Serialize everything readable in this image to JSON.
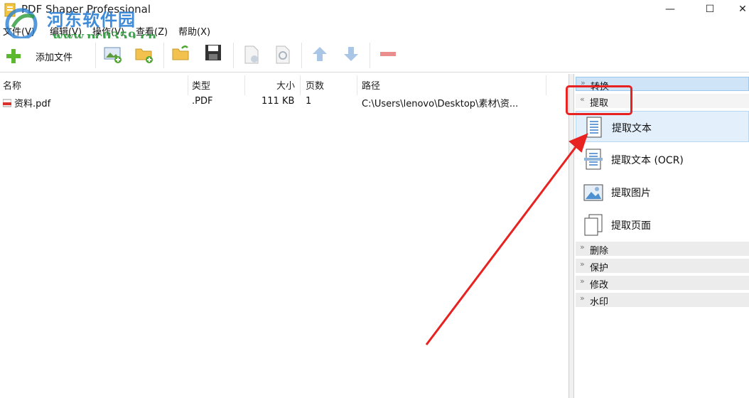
{
  "window": {
    "title": "PDF Shaper Professional",
    "controls": {
      "minimize": "—",
      "maximize": "☐",
      "close": "✕"
    }
  },
  "watermark": {
    "site_name": "河东软件园",
    "url": "www.pc0359.cn"
  },
  "menu": {
    "items": [
      {
        "label": "文件(V)"
      },
      {
        "label": "编辑(V)"
      },
      {
        "label": "操作(V)"
      },
      {
        "label": "查看(Z)"
      },
      {
        "label": "帮助(X)"
      }
    ]
  },
  "toolbar": {
    "add_file_label": "添加文件",
    "icons": [
      "add-icon",
      "add-image-icon",
      "add-folder-icon",
      "open-folder-icon",
      "save-icon",
      "document-info-icon",
      "preview-icon",
      "move-up-icon",
      "move-down-icon",
      "remove-icon"
    ]
  },
  "filelist": {
    "columns": [
      "名称",
      "类型",
      "大小",
      "页数",
      "路径"
    ],
    "rows": [
      {
        "name": "资料.pdf",
        "type": ".PDF",
        "size": "111 KB",
        "pages": "1",
        "path": "C:\\Users\\lenovo\\Desktop\\素材\\资..."
      }
    ]
  },
  "panel": {
    "sections": [
      {
        "label": "转换",
        "chevron": "»",
        "state": "collapsed-active"
      },
      {
        "label": "提取",
        "chevron": "«",
        "state": "expanded"
      },
      {
        "label": "删除",
        "chevron": "»",
        "state": "collapsed"
      },
      {
        "label": "保护",
        "chevron": "»",
        "state": "collapsed"
      },
      {
        "label": "修改",
        "chevron": "»",
        "state": "collapsed"
      },
      {
        "label": "水印",
        "chevron": "»",
        "state": "collapsed"
      }
    ],
    "extract_items": [
      {
        "label": "提取文本",
        "icon": "text-document-icon",
        "selected": true
      },
      {
        "label": "提取文本 (OCR)",
        "icon": "ocr-document-icon",
        "selected": false
      },
      {
        "label": "提取图片",
        "icon": "image-icon",
        "selected": false
      },
      {
        "label": "提取页面",
        "icon": "pages-icon",
        "selected": false
      }
    ]
  },
  "colors": {
    "annotation_red": "#e82121",
    "selection_blue": "#e3f0fb",
    "section_header": "#ececec",
    "watermark_blue": "#2b7fd4",
    "watermark_green": "#2b9a3a"
  }
}
